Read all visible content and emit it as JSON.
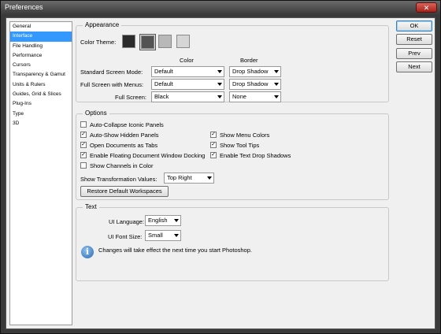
{
  "window": {
    "title": "Preferences",
    "close_glyph": "✕"
  },
  "sidebar": {
    "items": [
      {
        "label": "General"
      },
      {
        "label": "Interface",
        "selected": true
      },
      {
        "label": "File Handling"
      },
      {
        "label": "Performance"
      },
      {
        "label": "Cursors"
      },
      {
        "label": "Transparency & Gamut"
      },
      {
        "label": "Units & Rulers"
      },
      {
        "label": "Guides, Grid & Slices"
      },
      {
        "label": "Plug-Ins"
      },
      {
        "label": "Type"
      },
      {
        "label": "3D"
      }
    ]
  },
  "buttons": {
    "ok": "OK",
    "reset": "Reset",
    "prev": "Prev",
    "next": "Next"
  },
  "appearance": {
    "title": "Appearance",
    "color_theme_label": "Color Theme:",
    "themes": [
      "#2b2b2b",
      "#535353",
      "#b8b8b8",
      "#d6d6d6"
    ],
    "selected_theme_index": 1,
    "col_color": "Color",
    "col_border": "Border",
    "rows": [
      {
        "label": "Standard Screen Mode:",
        "color": "Default",
        "border": "Drop Shadow"
      },
      {
        "label": "Full Screen with Menus:",
        "color": "Default",
        "border": "Drop Shadow"
      },
      {
        "label": "Full Screen:",
        "color": "Black",
        "border": "None"
      }
    ]
  },
  "options": {
    "title": "Options",
    "checkboxes": [
      {
        "label": "Auto-Collapse Iconic Panels",
        "checked": false
      },
      {
        "label": "Auto-Show Hidden Panels",
        "checked": true
      },
      {
        "label": "Open Documents as Tabs",
        "checked": true
      },
      {
        "label": "Enable Floating Document Window Docking",
        "checked": true
      },
      {
        "label": "Show Channels in Color",
        "checked": false
      },
      {
        "label": "Show Menu Colors",
        "checked": true
      },
      {
        "label": "Show Tool Tips",
        "checked": true
      },
      {
        "label": "Enable Text Drop Shadows",
        "checked": true
      }
    ],
    "transform_label": "Show Transformation Values:",
    "transform_value": "Top Right",
    "restore_button": "Restore Default Workspaces"
  },
  "text": {
    "title": "Text",
    "ui_language_label": "UI Language:",
    "ui_language_value": "English",
    "ui_font_size_label": "UI Font Size:",
    "ui_font_size_value": "Small",
    "info_icon_glyph": "i",
    "info_message": "Changes will take effect the next time you start Photoshop."
  }
}
